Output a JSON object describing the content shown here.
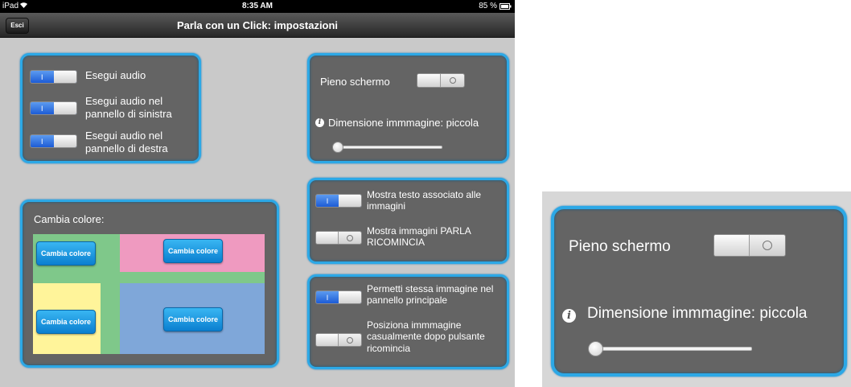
{
  "status_bar": {
    "device": "iPad",
    "wifi_icon": "wifi-icon",
    "time": "8:35 AM",
    "battery": "85 %",
    "battery_icon": "battery-icon"
  },
  "nav": {
    "title": "Parla con un Click: impostazioni",
    "exit_label": "Esci"
  },
  "audio_panel": {
    "items": [
      {
        "label": "Esegui audio",
        "state": "on"
      },
      {
        "label": "Esegui audio nel pannello di sinistra",
        "state": "on"
      },
      {
        "label": "Esegui audio nel pannello di destra",
        "state": "on"
      }
    ]
  },
  "display_panel": {
    "fullscreen_label": "Pieno schermo",
    "fullscreen_state": "off",
    "info_icon": "info-icon",
    "image_size_label": "Dimensione immmagine: piccola",
    "slider_value": 0
  },
  "text_panel": {
    "items": [
      {
        "label": "Mostra testo associato alle immagini",
        "state": "on"
      },
      {
        "label": "Mostra immagini PARLA RICOMINCIA",
        "state": "off"
      }
    ]
  },
  "image_panel": {
    "items": [
      {
        "label": "Permetti stessa immagine nel pannello principale",
        "state": "on"
      },
      {
        "label": "Posiziona immmagine casualmente dopo pulsante ricomincia",
        "state": "off"
      }
    ]
  },
  "color_panel": {
    "title": "Cambia colore:",
    "button_label": "Cambia colore",
    "colors": {
      "green": "#7fc88a",
      "pink": "#ef9ac0",
      "yellow": "#fff49a",
      "blue": "#7fa7d9"
    }
  },
  "zoom_inset": {
    "fullscreen_label": "Pieno schermo",
    "image_size_label": "Dimensione immmagine: piccola"
  },
  "colors": {
    "accent": "#2ca8e6",
    "panel": "#646464",
    "background": "#c9c9c9"
  }
}
